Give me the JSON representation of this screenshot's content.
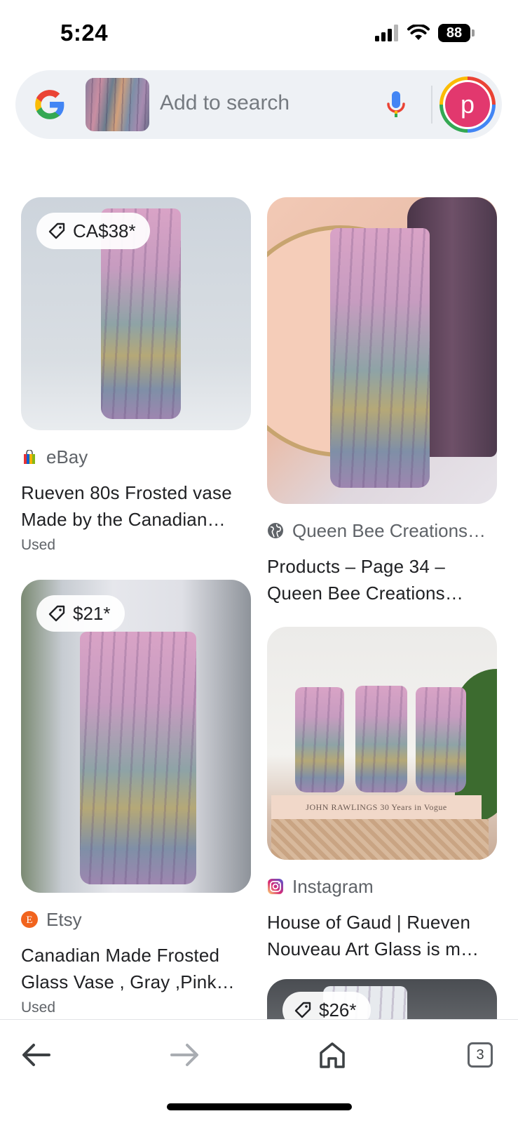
{
  "status_bar": {
    "time": "5:24",
    "battery": "88"
  },
  "search": {
    "placeholder": "Add to search",
    "avatar_letter": "p"
  },
  "results": [
    {
      "price": "CA$38*",
      "source": "eBay",
      "title": "Rueven 80s Frosted vase Made by the Canadian…",
      "condition": "Used"
    },
    {
      "source": "Queen Bee Creations…",
      "title": "Products – Page 34 – Queen Bee Creations…"
    },
    {
      "price": "$21*",
      "source": "Etsy",
      "title": "Canadian Made Frosted Glass Vase , Gray ,Pink…",
      "condition": "Used"
    },
    {
      "source": "Instagram",
      "title": "House of Gaud | Rueven Nouveau Art Glass is m…",
      "book_text": "JOHN RAWLINGS  30 Years in Vogue"
    },
    {
      "price": "$26*"
    }
  ],
  "nav": {
    "tab_count": "3"
  },
  "colors": {
    "avatar": "#e2386e",
    "etsy": "#f1641e",
    "background": "#ffffff"
  }
}
